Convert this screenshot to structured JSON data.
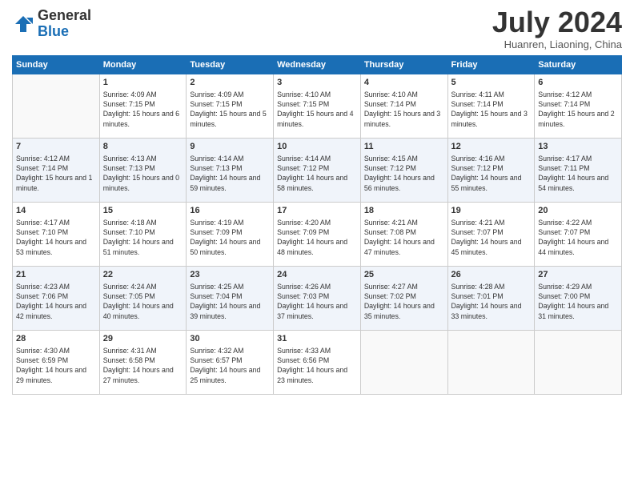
{
  "logo": {
    "general": "General",
    "blue": "Blue"
  },
  "header": {
    "month": "July 2024",
    "location": "Huanren, Liaoning, China"
  },
  "weekdays": [
    "Sunday",
    "Monday",
    "Tuesday",
    "Wednesday",
    "Thursday",
    "Friday",
    "Saturday"
  ],
  "weeks": [
    [
      {
        "day": "",
        "sunrise": "",
        "sunset": "",
        "daylight": ""
      },
      {
        "day": "1",
        "sunrise": "Sunrise: 4:09 AM",
        "sunset": "Sunset: 7:15 PM",
        "daylight": "Daylight: 15 hours and 6 minutes."
      },
      {
        "day": "2",
        "sunrise": "Sunrise: 4:09 AM",
        "sunset": "Sunset: 7:15 PM",
        "daylight": "Daylight: 15 hours and 5 minutes."
      },
      {
        "day": "3",
        "sunrise": "Sunrise: 4:10 AM",
        "sunset": "Sunset: 7:15 PM",
        "daylight": "Daylight: 15 hours and 4 minutes."
      },
      {
        "day": "4",
        "sunrise": "Sunrise: 4:10 AM",
        "sunset": "Sunset: 7:14 PM",
        "daylight": "Daylight: 15 hours and 3 minutes."
      },
      {
        "day": "5",
        "sunrise": "Sunrise: 4:11 AM",
        "sunset": "Sunset: 7:14 PM",
        "daylight": "Daylight: 15 hours and 3 minutes."
      },
      {
        "day": "6",
        "sunrise": "Sunrise: 4:12 AM",
        "sunset": "Sunset: 7:14 PM",
        "daylight": "Daylight: 15 hours and 2 minutes."
      }
    ],
    [
      {
        "day": "7",
        "sunrise": "Sunrise: 4:12 AM",
        "sunset": "Sunset: 7:14 PM",
        "daylight": "Daylight: 15 hours and 1 minute."
      },
      {
        "day": "8",
        "sunrise": "Sunrise: 4:13 AM",
        "sunset": "Sunset: 7:13 PM",
        "daylight": "Daylight: 15 hours and 0 minutes."
      },
      {
        "day": "9",
        "sunrise": "Sunrise: 4:14 AM",
        "sunset": "Sunset: 7:13 PM",
        "daylight": "Daylight: 14 hours and 59 minutes."
      },
      {
        "day": "10",
        "sunrise": "Sunrise: 4:14 AM",
        "sunset": "Sunset: 7:12 PM",
        "daylight": "Daylight: 14 hours and 58 minutes."
      },
      {
        "day": "11",
        "sunrise": "Sunrise: 4:15 AM",
        "sunset": "Sunset: 7:12 PM",
        "daylight": "Daylight: 14 hours and 56 minutes."
      },
      {
        "day": "12",
        "sunrise": "Sunrise: 4:16 AM",
        "sunset": "Sunset: 7:12 PM",
        "daylight": "Daylight: 14 hours and 55 minutes."
      },
      {
        "day": "13",
        "sunrise": "Sunrise: 4:17 AM",
        "sunset": "Sunset: 7:11 PM",
        "daylight": "Daylight: 14 hours and 54 minutes."
      }
    ],
    [
      {
        "day": "14",
        "sunrise": "Sunrise: 4:17 AM",
        "sunset": "Sunset: 7:10 PM",
        "daylight": "Daylight: 14 hours and 53 minutes."
      },
      {
        "day": "15",
        "sunrise": "Sunrise: 4:18 AM",
        "sunset": "Sunset: 7:10 PM",
        "daylight": "Daylight: 14 hours and 51 minutes."
      },
      {
        "day": "16",
        "sunrise": "Sunrise: 4:19 AM",
        "sunset": "Sunset: 7:09 PM",
        "daylight": "Daylight: 14 hours and 50 minutes."
      },
      {
        "day": "17",
        "sunrise": "Sunrise: 4:20 AM",
        "sunset": "Sunset: 7:09 PM",
        "daylight": "Daylight: 14 hours and 48 minutes."
      },
      {
        "day": "18",
        "sunrise": "Sunrise: 4:21 AM",
        "sunset": "Sunset: 7:08 PM",
        "daylight": "Daylight: 14 hours and 47 minutes."
      },
      {
        "day": "19",
        "sunrise": "Sunrise: 4:21 AM",
        "sunset": "Sunset: 7:07 PM",
        "daylight": "Daylight: 14 hours and 45 minutes."
      },
      {
        "day": "20",
        "sunrise": "Sunrise: 4:22 AM",
        "sunset": "Sunset: 7:07 PM",
        "daylight": "Daylight: 14 hours and 44 minutes."
      }
    ],
    [
      {
        "day": "21",
        "sunrise": "Sunrise: 4:23 AM",
        "sunset": "Sunset: 7:06 PM",
        "daylight": "Daylight: 14 hours and 42 minutes."
      },
      {
        "day": "22",
        "sunrise": "Sunrise: 4:24 AM",
        "sunset": "Sunset: 7:05 PM",
        "daylight": "Daylight: 14 hours and 40 minutes."
      },
      {
        "day": "23",
        "sunrise": "Sunrise: 4:25 AM",
        "sunset": "Sunset: 7:04 PM",
        "daylight": "Daylight: 14 hours and 39 minutes."
      },
      {
        "day": "24",
        "sunrise": "Sunrise: 4:26 AM",
        "sunset": "Sunset: 7:03 PM",
        "daylight": "Daylight: 14 hours and 37 minutes."
      },
      {
        "day": "25",
        "sunrise": "Sunrise: 4:27 AM",
        "sunset": "Sunset: 7:02 PM",
        "daylight": "Daylight: 14 hours and 35 minutes."
      },
      {
        "day": "26",
        "sunrise": "Sunrise: 4:28 AM",
        "sunset": "Sunset: 7:01 PM",
        "daylight": "Daylight: 14 hours and 33 minutes."
      },
      {
        "day": "27",
        "sunrise": "Sunrise: 4:29 AM",
        "sunset": "Sunset: 7:00 PM",
        "daylight": "Daylight: 14 hours and 31 minutes."
      }
    ],
    [
      {
        "day": "28",
        "sunrise": "Sunrise: 4:30 AM",
        "sunset": "Sunset: 6:59 PM",
        "daylight": "Daylight: 14 hours and 29 minutes."
      },
      {
        "day": "29",
        "sunrise": "Sunrise: 4:31 AM",
        "sunset": "Sunset: 6:58 PM",
        "daylight": "Daylight: 14 hours and 27 minutes."
      },
      {
        "day": "30",
        "sunrise": "Sunrise: 4:32 AM",
        "sunset": "Sunset: 6:57 PM",
        "daylight": "Daylight: 14 hours and 25 minutes."
      },
      {
        "day": "31",
        "sunrise": "Sunrise: 4:33 AM",
        "sunset": "Sunset: 6:56 PM",
        "daylight": "Daylight: 14 hours and 23 minutes."
      },
      {
        "day": "",
        "sunrise": "",
        "sunset": "",
        "daylight": ""
      },
      {
        "day": "",
        "sunrise": "",
        "sunset": "",
        "daylight": ""
      },
      {
        "day": "",
        "sunrise": "",
        "sunset": "",
        "daylight": ""
      }
    ]
  ]
}
